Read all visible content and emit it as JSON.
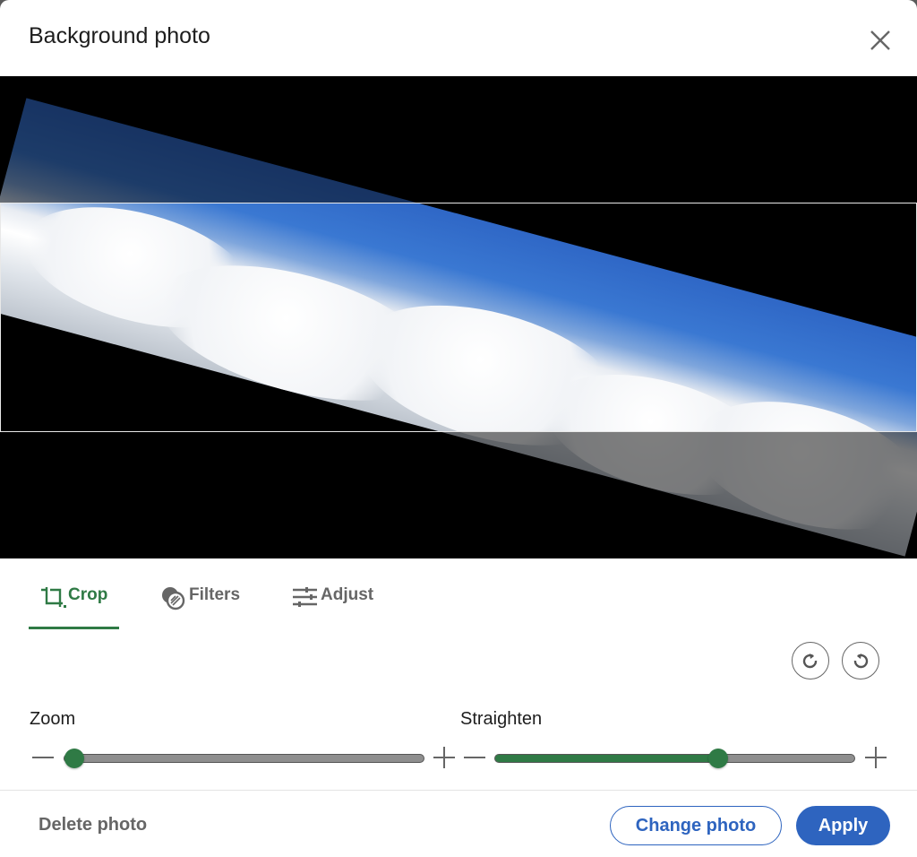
{
  "dialog": {
    "title": "Background photo",
    "close_icon": "close-icon"
  },
  "tabs": [
    {
      "label": "Crop",
      "icon": "crop-icon",
      "active": true
    },
    {
      "label": "Filters",
      "icon": "filters-icon",
      "active": false
    },
    {
      "label": "Adjust",
      "icon": "adjust-icon",
      "active": false
    }
  ],
  "rotate": {
    "left_icon": "rotate-left-icon",
    "right_icon": "rotate-right-icon"
  },
  "sliders": {
    "zoom": {
      "label": "Zoom",
      "value_percent": 0
    },
    "straighten": {
      "label": "Straighten",
      "value_percent": 62
    }
  },
  "footer": {
    "delete_label": "Delete photo",
    "change_label": "Change photo",
    "apply_label": "Apply"
  },
  "colors": {
    "accent_green": "#2f7a45",
    "primary_blue": "#2e64bf"
  }
}
